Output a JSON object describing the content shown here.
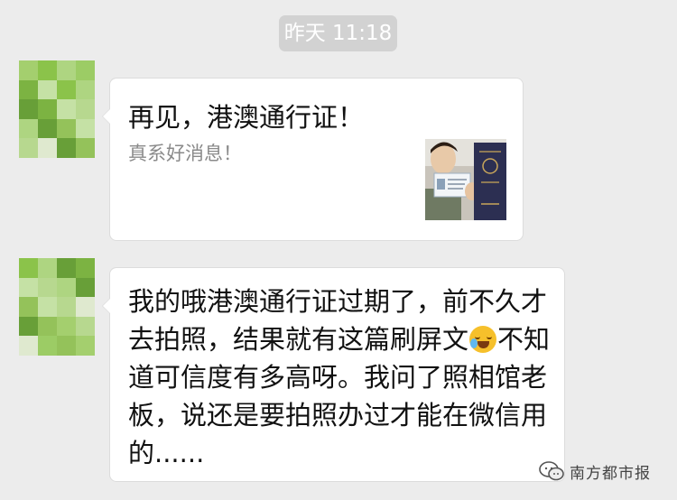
{
  "chat": {
    "timestamp": "昨天 11:18",
    "messages": [
      {
        "kind": "link-card",
        "title": "再见，港澳通行证！",
        "description": "真系好消息！",
        "thumbnail": "passport-photo"
      },
      {
        "kind": "text",
        "text_before_emoji": "我的哦港澳通行证过期了，前不久才去拍照，结果就有这篇刷屏文",
        "emoji": "crying-laughing-emoji",
        "text_after_emoji": "不知道可信度有多高呀。我问了照相馆老板，说还是要拍照办过才能在微信用的......"
      }
    ]
  },
  "watermark": {
    "text": "南方都市报",
    "icon": "wechat-official-account-icon"
  },
  "colors": {
    "background": "#ececec",
    "bubble": "#ffffff",
    "timestamp_bg": "#d2d2d2",
    "avatar_green": "#8bc34a"
  }
}
